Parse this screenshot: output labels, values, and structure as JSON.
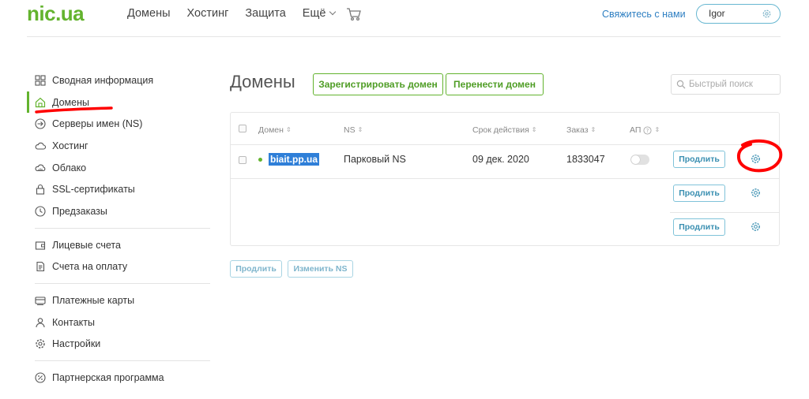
{
  "header": {
    "logo": "nic.ua",
    "nav": [
      "Домены",
      "Хостинг",
      "Защита",
      "Ещё"
    ],
    "contact_link": "Свяжитесь с нами",
    "user_name": "Igor"
  },
  "sidebar": {
    "groups": [
      [
        "Сводная информация",
        "Домены",
        "Серверы имен (NS)",
        "Хостинг",
        "Облако",
        "SSL-сертификаты",
        "Предзаказы"
      ],
      [
        "Лицевые счета",
        "Счета на оплату"
      ],
      [
        "Платежные карты",
        "Контакты",
        "Настройки"
      ],
      [
        "Партнерская программа"
      ]
    ],
    "active": "Домены"
  },
  "main": {
    "title": "Домены",
    "register_button": "Зарегистрировать домен",
    "transfer_button": "Перенести домен",
    "search_placeholder": "Быстрый поиск",
    "columns": {
      "domain": "Домен",
      "ns": "NS",
      "expiry": "Срок действия",
      "order": "Заказ",
      "autorenew": "АП"
    },
    "rows": [
      {
        "domain": "biait.pp.ua",
        "ns": "Парковый NS",
        "expiry": "09 дек. 2020",
        "order": "1833047",
        "renew": "Продлить"
      },
      {
        "renew": "Продлить"
      },
      {
        "renew": "Продлить"
      }
    ],
    "bottom_renew": "Продлить",
    "bottom_change_ns": "Изменить NS"
  },
  "colors": {
    "brand_green": "#63b32e",
    "link_blue": "#2e7fc2",
    "annotation_red": "#ff0000"
  }
}
